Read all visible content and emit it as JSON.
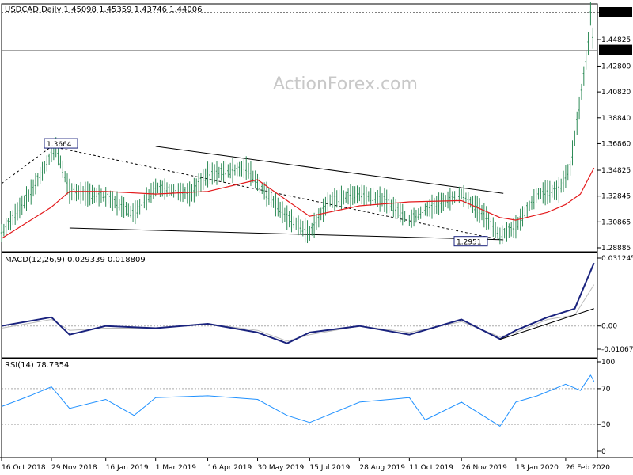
{
  "chart_data": [
    {
      "type": "candlestick",
      "title": "USDCAD,Daily  1.45098 1.45359 1.43746 1.44006",
      "watermark": "ActionForex.com",
      "y_ticks": [
        "1.46890",
        "1.44825",
        "1.42800",
        "1.40820",
        "1.38840",
        "1.36860",
        "1.34825",
        "1.32845",
        "1.30865",
        "1.28885"
      ],
      "current_price_label": "1.44006",
      "annotations": [
        {
          "label": "1.3664",
          "x": "29 Nov 2018",
          "y": 1.3664
        },
        {
          "label": "1.2951",
          "x": "30 Dec 2019",
          "y": 1.2951
        }
      ],
      "series": [
        {
          "name": "price",
          "x": [
            "2018-10-16",
            "2018-11-10",
            "2018-12-03",
            "2018-12-15",
            "2019-01-16",
            "2019-02-10",
            "2019-03-01",
            "2019-04-01",
            "2019-04-16",
            "2019-05-20",
            "2019-06-07",
            "2019-06-25",
            "2019-07-15",
            "2019-08-01",
            "2019-08-28",
            "2019-09-20",
            "2019-10-11",
            "2019-10-25",
            "2019-11-26",
            "2019-12-15",
            "2019-12-30",
            "2020-01-13",
            "2020-02-01",
            "2020-02-20",
            "2020-03-01",
            "2020-03-08",
            "2020-03-17",
            "2020-03-19",
            "2020-03-22"
          ],
          "values": [
            1.3,
            1.33,
            1.366,
            1.332,
            1.328,
            1.315,
            1.335,
            1.33,
            1.345,
            1.35,
            1.33,
            1.312,
            1.3,
            1.325,
            1.33,
            1.325,
            1.31,
            1.318,
            1.33,
            1.315,
            1.298,
            1.305,
            1.33,
            1.333,
            1.35,
            1.39,
            1.445,
            1.468,
            1.44
          ]
        },
        {
          "name": "moving average",
          "x": [
            "2018-10-16",
            "2018-11-29",
            "2018-12-15",
            "2019-01-16",
            "2019-03-01",
            "2019-04-16",
            "2019-05-30",
            "2019-06-25",
            "2019-07-15",
            "2019-08-28",
            "2019-10-11",
            "2019-11-26",
            "2019-12-30",
            "2020-01-13",
            "2020-02-10",
            "2020-02-26",
            "2020-03-10",
            "2020-03-22"
          ],
          "values": [
            1.296,
            1.32,
            1.332,
            1.332,
            1.33,
            1.332,
            1.341,
            1.325,
            1.313,
            1.321,
            1.324,
            1.325,
            1.312,
            1.31,
            1.316,
            1.322,
            1.33,
            1.35
          ]
        }
      ],
      "trendlines": [
        {
          "style": "solid",
          "from": [
            "2019-03-01",
            1.3665
          ],
          "to": [
            "2020-01-02",
            1.3305
          ]
        },
        {
          "style": "solid",
          "from": [
            "2018-12-15",
            1.304
          ],
          "to": [
            "2020-01-02",
            1.295
          ]
        },
        {
          "style": "dashed",
          "from": [
            "2018-10-16",
            1.338
          ],
          "to": [
            "2018-11-29",
            1.3664
          ]
        },
        {
          "style": "dashed",
          "from": [
            "2018-11-29",
            1.3664
          ],
          "to": [
            "2019-12-30",
            1.2951
          ]
        }
      ]
    },
    {
      "type": "line",
      "title": "MACD(12,26,9) 0.029339 0.018809",
      "y_ticks": [
        "0.031245",
        "0.00",
        "-0.010678"
      ],
      "series": [
        {
          "name": "MACD",
          "x": [
            "2018-10-16",
            "2018-11-29",
            "2018-12-15",
            "2019-01-16",
            "2019-03-01",
            "2019-04-16",
            "2019-05-30",
            "2019-06-25",
            "2019-07-15",
            "2019-08-28",
            "2019-10-11",
            "2019-11-26",
            "2019-12-30",
            "2020-01-13",
            "2020-02-10",
            "2020-03-05",
            "2020-03-22"
          ],
          "values": [
            0.0,
            0.004,
            -0.004,
            0.0,
            -0.001,
            0.001,
            -0.003,
            -0.008,
            -0.003,
            0.0,
            -0.004,
            0.003,
            -0.006,
            -0.002,
            0.004,
            0.008,
            0.029
          ]
        },
        {
          "name": "signal",
          "x": [
            "2018-10-16",
            "2018-11-29",
            "2018-12-15",
            "2019-01-16",
            "2019-03-01",
            "2019-04-16",
            "2019-05-30",
            "2019-06-25",
            "2019-07-15",
            "2019-08-28",
            "2019-10-11",
            "2019-11-26",
            "2019-12-30",
            "2020-01-13",
            "2020-02-10",
            "2020-03-05",
            "2020-03-22"
          ],
          "values": [
            -0.001,
            0.003,
            -0.002,
            -0.001,
            -0.001,
            0.001,
            -0.002,
            -0.007,
            -0.004,
            0.0,
            -0.003,
            0.002,
            -0.005,
            -0.003,
            0.003,
            0.005,
            0.019
          ]
        }
      ],
      "trendlines": [
        {
          "style": "solid",
          "from": [
            "2019-12-30",
            -0.0062
          ],
          "to": [
            "2020-03-22",
            0.008
          ]
        }
      ]
    },
    {
      "type": "line",
      "title": "RSI(14) 78.7354",
      "y_ticks": [
        "100",
        "70",
        "30",
        "0"
      ],
      "ylim": [
        0,
        100
      ],
      "series": [
        {
          "name": "RSI",
          "x": [
            "2018-10-16",
            "2018-11-10",
            "2018-11-29",
            "2018-12-15",
            "2019-01-16",
            "2019-02-10",
            "2019-03-01",
            "2019-04-16",
            "2019-05-30",
            "2019-06-25",
            "2019-07-15",
            "2019-08-28",
            "2019-10-11",
            "2019-10-25",
            "2019-11-26",
            "2019-12-30",
            "2020-01-13",
            "2020-02-01",
            "2020-02-26",
            "2020-03-10",
            "2020-03-19",
            "2020-03-22"
          ],
          "values": [
            50,
            62,
            72,
            48,
            58,
            40,
            60,
            62,
            58,
            40,
            32,
            55,
            60,
            35,
            55,
            28,
            55,
            62,
            75,
            68,
            85,
            78
          ]
        }
      ]
    }
  ],
  "x_axis": {
    "labels": [
      "16 Oct 2018",
      "29 Nov 2018",
      "16 Jan 2019",
      "1 Mar 2019",
      "16 Apr 2019",
      "30 May 2019",
      "15 Jul 2019",
      "28 Aug 2019",
      "11 Oct 2019",
      "26 Nov 2019",
      "13 Jan 2020",
      "26 Feb 2020"
    ],
    "label_dates": [
      "2018-10-16",
      "2018-11-29",
      "2019-01-16",
      "2019-03-01",
      "2019-04-16",
      "2019-05-30",
      "2019-07-15",
      "2019-08-28",
      "2019-10-11",
      "2019-11-26",
      "2020-01-13",
      "2020-02-26"
    ]
  },
  "colors": {
    "price": "#2e8b57",
    "ma": "#e31a1c",
    "macd": "#1a237e",
    "signal": "#bbbbbb",
    "rsi": "#1e90ff",
    "trend": "#000000"
  }
}
